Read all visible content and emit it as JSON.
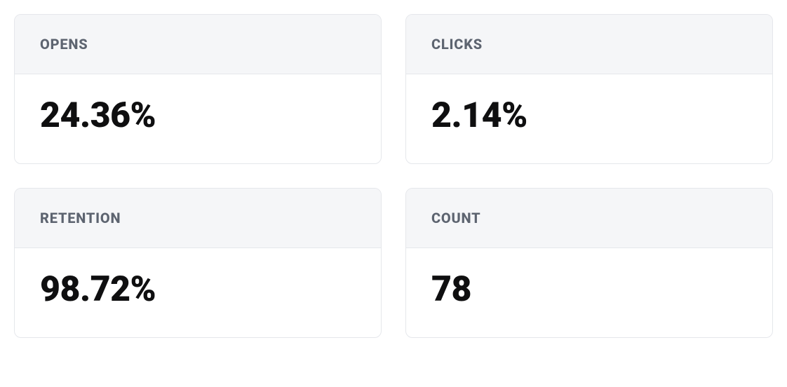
{
  "stats": {
    "opens": {
      "label": "OPENS",
      "value": "24.36%"
    },
    "clicks": {
      "label": "CLICKS",
      "value": "2.14%"
    },
    "retention": {
      "label": "RETENTION",
      "value": "98.72%"
    },
    "count": {
      "label": "COUNT",
      "value": "78"
    }
  }
}
